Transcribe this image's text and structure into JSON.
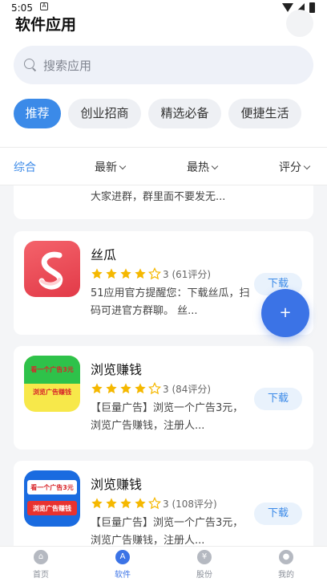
{
  "status_bar": {
    "time": "5:05",
    "notification_icon": "A"
  },
  "header": {
    "title": "软件应用"
  },
  "search": {
    "placeholder": "搜索应用"
  },
  "categories": [
    "推荐",
    "创业招商",
    "精选必备",
    "便捷生活"
  ],
  "sort_options": [
    "综合",
    "最新",
    "最热",
    "评分"
  ],
  "apps": [
    {
      "snippet": "大家进群，群里面不要发无..."
    },
    {
      "name": "丝瓜",
      "stars": 4,
      "rating": "3 (61评分)",
      "description": "51应用官方提醒您：下载丝瓜，扫码可进官方群聊。 丝...",
      "download": "下载",
      "icon_color": "#ee4a55"
    },
    {
      "name": "浏览赚钱",
      "stars": 4,
      "rating": "3 (84评分)",
      "description": "【巨量广告】浏览一个广告3元，浏览广告赚钱，注册人...",
      "download": "下载",
      "icon_line1": "看一个广告3元",
      "icon_line2": "浏览广告赚钱"
    },
    {
      "name": "浏览赚钱",
      "stars": 4,
      "rating": "3 (108评分)",
      "description": "【巨量广告】浏览一个广告3元，浏览广告赚钱，注册人...",
      "download": "下载",
      "icon_line1": "看一个广告3元",
      "icon_line2": "浏览广告赚钱"
    }
  ],
  "fab": {
    "symbol": "+"
  },
  "tabbar": [
    {
      "label": "首页",
      "icon": "home-icon"
    },
    {
      "label": "软件",
      "icon": "apps-icon"
    },
    {
      "label": "股份",
      "icon": "share-icon"
    },
    {
      "label": "我的",
      "icon": "profile-icon"
    }
  ],
  "colors": {
    "accent": "#3b8ae8",
    "fab": "#3b73e6",
    "star": "#f5b800"
  }
}
